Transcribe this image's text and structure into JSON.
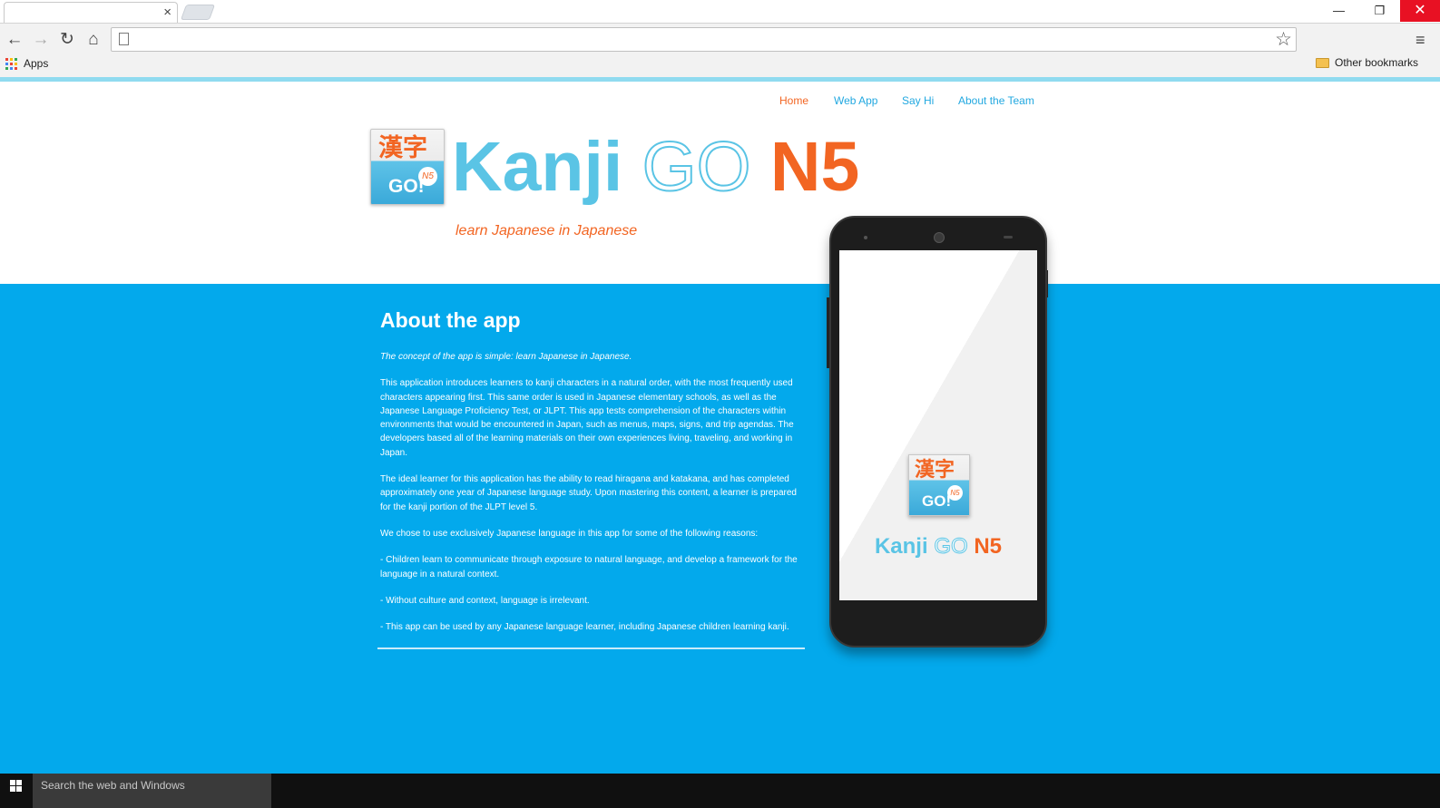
{
  "browser": {
    "tab_close": "×",
    "window_controls": {
      "minimize": "—",
      "maximize": "❐",
      "close": "✕"
    },
    "nav": {
      "back": "←",
      "forward": "→",
      "reload": "↻",
      "home": "⌂"
    },
    "bookmark_star": "☆",
    "menu": "≡",
    "bookmarks": {
      "apps_label": "Apps",
      "other_label": "Other bookmarks"
    },
    "apps_grid_colors": [
      "#ea4335",
      "#fbbc05",
      "#34a853",
      "#4285f4",
      "#ea4335",
      "#fbbc05",
      "#34a853",
      "#4285f4",
      "#ea4335"
    ]
  },
  "site": {
    "nav": {
      "items": [
        {
          "label": "Home",
          "active": true
        },
        {
          "label": "Web App"
        },
        {
          "label": "Say Hi"
        },
        {
          "label": "About the Team"
        }
      ]
    },
    "logo_icon": {
      "kanji": "漢字",
      "go": "GO!",
      "badge": "N5"
    },
    "brand": {
      "kanji": "Kanji",
      "go": "GO",
      "n5": "N5"
    },
    "tagline": "learn Japanese in Japanese",
    "about": {
      "title": "About the app",
      "paragraphs": [
        "The concept of the app is simple: learn Japanese in Japanese.",
        "This application introduces learners to kanji characters in a natural order, with the most frequently used characters appearing first. This same order is used in Japanese elementary schools, as well as the Japanese Language Proficiency Test, or JLPT. This app tests comprehension of the characters within environments that would be encountered in Japan, such as menus, maps, signs, and trip agendas. The developers based all of the learning materials on their own experiences living, traveling, and working in Japan.",
        "The ideal learner for this application has the ability to read hiragana and katakana, and has completed approximately one year of Japanese language study. Upon mastering this content, a learner is prepared for the kanji portion of the JLPT level 5.",
        "We chose to use exclusively Japanese language in this app for some of the following reasons:",
        "- Children learn to communicate through exposure to natural language, and develop a framework for the language in a natural context.",
        "- Without culture and context, language is irrelevant.",
        "- This app can be used by any Japanese language learner, including Japanese children learning kanji."
      ]
    },
    "phone": {
      "icon": {
        "kanji": "漢字",
        "go": "GO!",
        "badge": "N5"
      },
      "brand": {
        "kanji": "Kanji",
        "go": "GO",
        "n5": "N5"
      }
    },
    "colors": {
      "accent_blue": "#03a9ec",
      "brand_blue": "#5ac4e5",
      "brand_orange": "#f26522"
    }
  },
  "taskbar": {
    "search_placeholder": "Search the web and Windows"
  }
}
